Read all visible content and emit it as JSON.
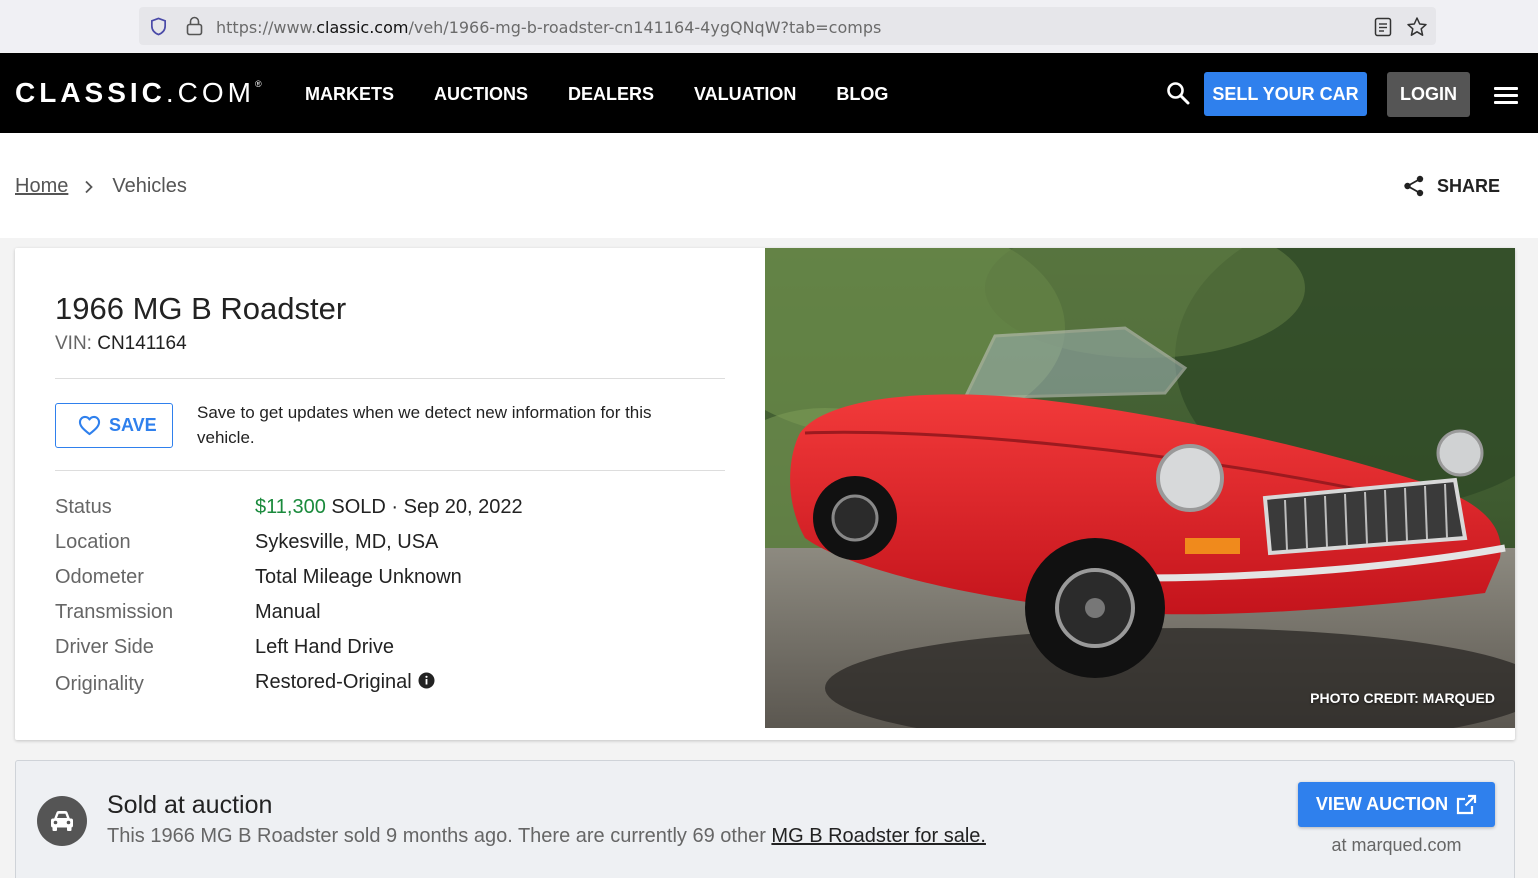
{
  "browser": {
    "url_prefix": "https://www.",
    "url_host": "classic.com",
    "url_path": "/veh/1966-mg-b-roadster-cn141164-4ygQNqW?tab=comps"
  },
  "header": {
    "logo_brand": "CLASSIC",
    "logo_tld": ".COM",
    "logo_mark": "®",
    "nav": [
      "MARKETS",
      "AUCTIONS",
      "DEALERS",
      "VALUATION",
      "BLOG"
    ],
    "sell_label": "SELL YOUR CAR",
    "login_label": "LOGIN"
  },
  "breadcrumb": {
    "home": "Home",
    "current": "Vehicles"
  },
  "share_label": "SHARE",
  "vehicle": {
    "title": "1966 MG B Roadster",
    "vin_label": "VIN:",
    "vin": "CN141164",
    "save_label": "SAVE",
    "save_note": "Save to get updates when we detect new information for this vehicle.",
    "specs": {
      "status": {
        "key": "Status",
        "price": "$11,300",
        "rest": "SOLD · Sep 20, 2022"
      },
      "location": {
        "key": "Location",
        "value": "Sykesville, MD, USA"
      },
      "odometer": {
        "key": "Odometer",
        "value": "Total Mileage Unknown"
      },
      "transmission": {
        "key": "Transmission",
        "value": "Manual"
      },
      "driver_side": {
        "key": "Driver Side",
        "value": "Left Hand Drive"
      },
      "originality": {
        "key": "Originality",
        "value": "Restored-Original"
      }
    },
    "photo_credit": "PHOTO CREDIT: MARQUED"
  },
  "sold_banner": {
    "title": "Sold at auction",
    "text": "This 1966 MG B Roadster sold 9 months ago. There are currently 69 other ",
    "link": "MG B Roadster for sale.",
    "button": "VIEW AUCTION",
    "source": "at marqued.com"
  },
  "colors": {
    "accent": "#2f80ed",
    "price_green": "#1a8a3c",
    "header_bg": "#000000",
    "car_red": "#e8202a"
  }
}
